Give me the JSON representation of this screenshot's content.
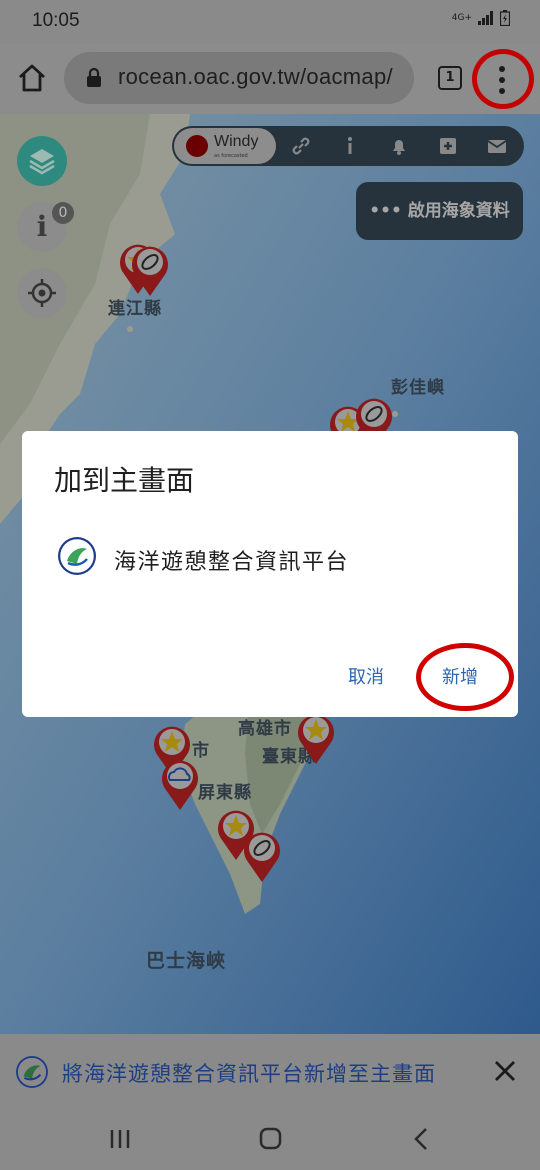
{
  "status_bar": {
    "time": "10:05",
    "network": "4G+"
  },
  "browser": {
    "url": "rocean.oac.gov.tw/oacmap/",
    "tab_count": "1"
  },
  "map": {
    "windy_label": "Windy",
    "windy_sub": "as forecasted",
    "ocean_data_button": "••• 啟用海象資料",
    "info_badge": "0",
    "labels": {
      "lienchiang": "連江縣",
      "penghu": "彭佳嶼",
      "kaohsiung": "高雄市",
      "taitung": "臺東縣",
      "pingtung": "屏東縣",
      "tainan_partial": "市",
      "bashi": "巴士海峽"
    }
  },
  "dialog": {
    "title": "加到主畫面",
    "app_name": "海洋遊憩整合資訊平台",
    "cancel_label": "取消",
    "add_label": "新增"
  },
  "banner": {
    "text": "將海洋遊憩整合資訊平台新增至主畫面"
  },
  "colors": {
    "dialog_button": "#2f66b0",
    "highlight_red": "#d10000",
    "banner_text": "#1c3f82"
  }
}
